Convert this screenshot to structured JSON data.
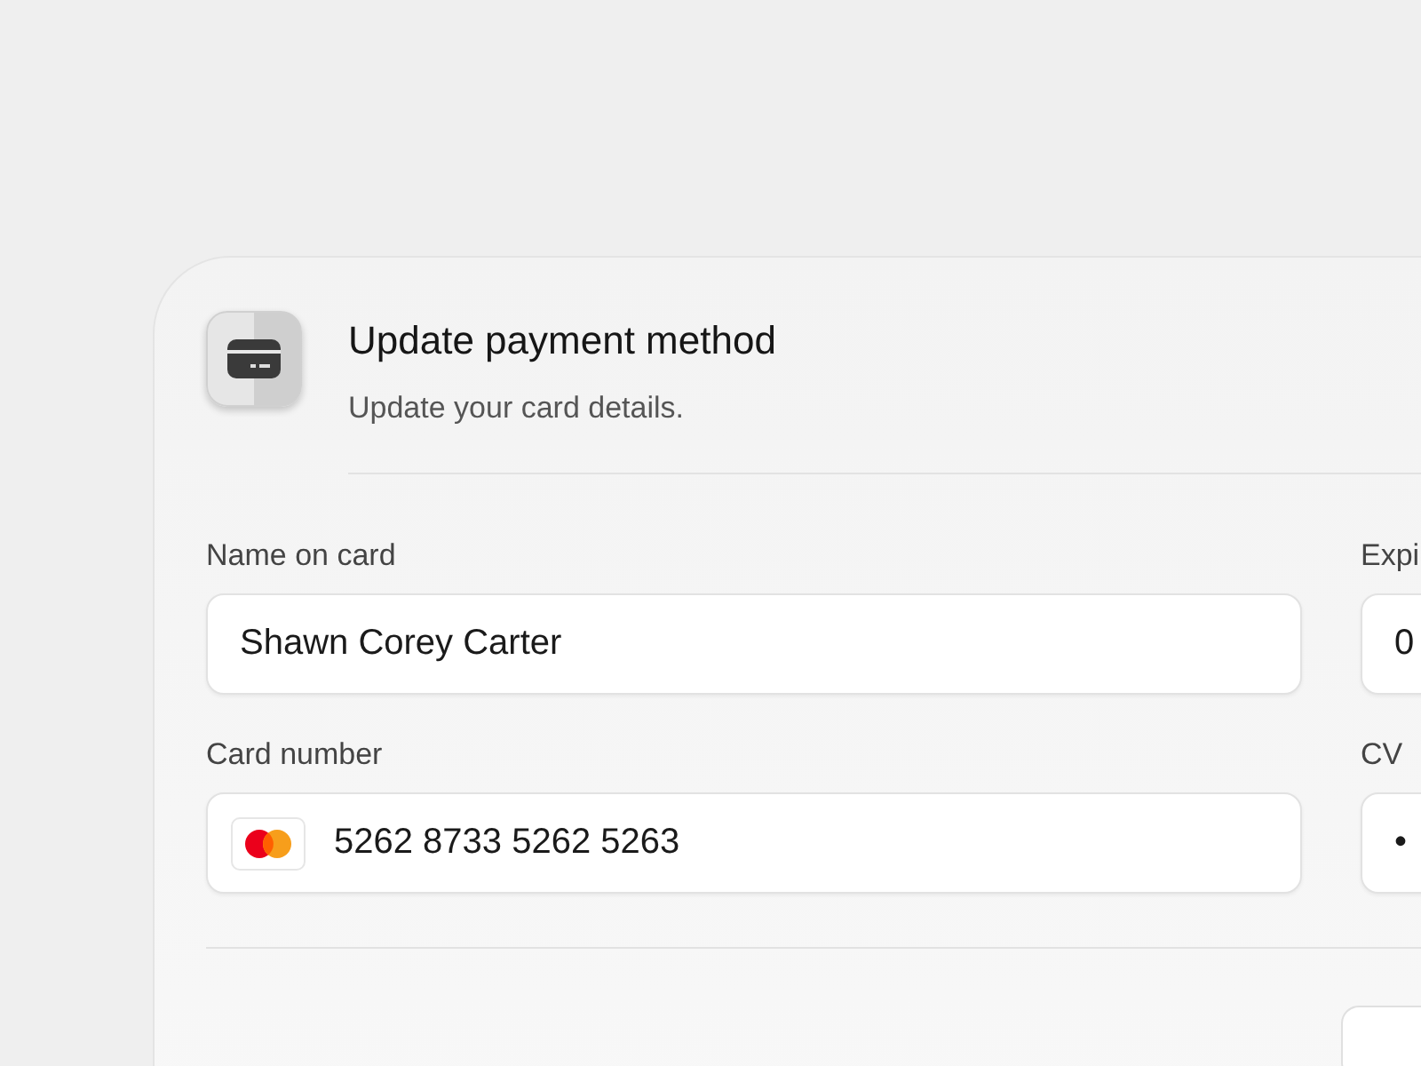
{
  "dialog": {
    "title": "Update payment method",
    "subtitle": "Update your card details."
  },
  "fields": [
    {
      "label": "Name on card",
      "value": "Shawn Corey Carter",
      "kind": "text"
    },
    {
      "label": "Expi",
      "value": "0",
      "kind": "text"
    },
    {
      "label": "Card number",
      "value": "5262 8733 5262 5263",
      "kind": "card"
    },
    {
      "label": "CV",
      "value": "•",
      "kind": "text"
    }
  ]
}
